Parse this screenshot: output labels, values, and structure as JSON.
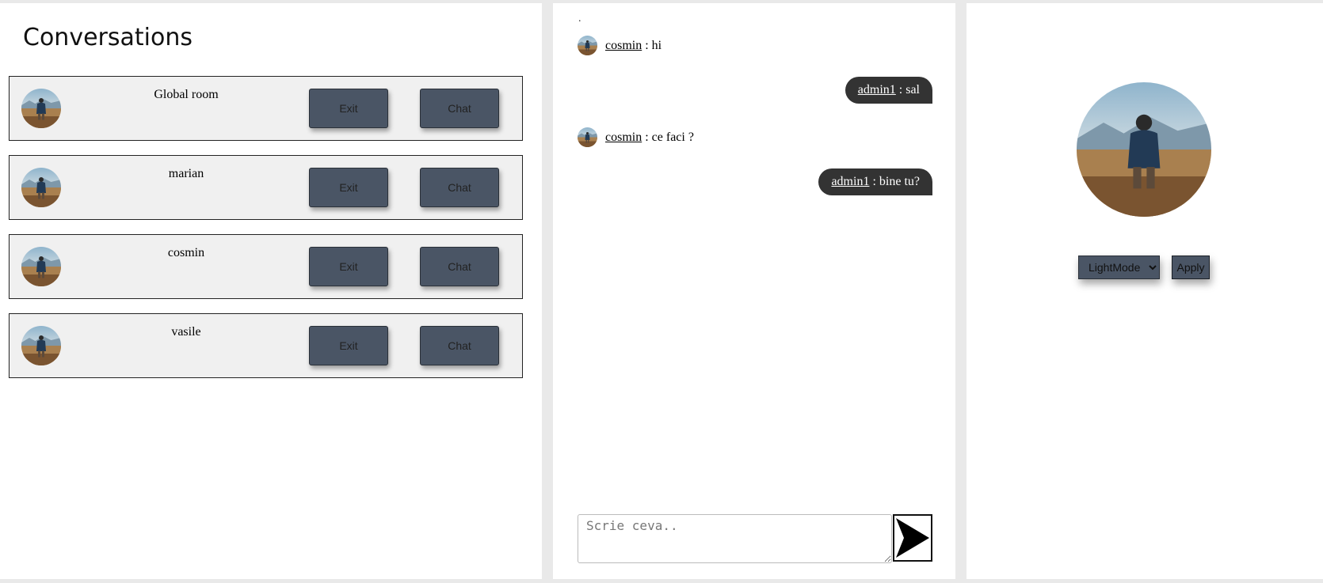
{
  "left": {
    "title": "Conversations",
    "conversations": [
      {
        "name": "Global room",
        "exit_label": "Exit",
        "chat_label": "Chat"
      },
      {
        "name": "marian",
        "exit_label": "Exit",
        "chat_label": "Chat"
      },
      {
        "name": "cosmin",
        "exit_label": "Exit",
        "chat_label": "Chat"
      },
      {
        "name": "vasile",
        "exit_label": "Exit",
        "chat_label": "Chat"
      }
    ]
  },
  "chat": {
    "top_mark": ".",
    "messages": [
      {
        "user": "cosmin",
        "text": " : hi",
        "direction": "incoming"
      },
      {
        "user": "admin1",
        "text": " : sal",
        "direction": "outgoing"
      },
      {
        "user": "cosmin",
        "text": " : ce faci ?",
        "direction": "incoming"
      },
      {
        "user": "admin1",
        "text": " : bine tu?",
        "direction": "outgoing"
      }
    ],
    "input_placeholder": "Scrie ceva..",
    "send_icon": "send-arrow-icon"
  },
  "profile": {
    "theme_selected": "LightMode",
    "apply_label": "Apply"
  },
  "colors": {
    "button_bg": "#4a5565",
    "outgoing_bubble": "#333333",
    "item_bg": "#f0f0f0"
  }
}
